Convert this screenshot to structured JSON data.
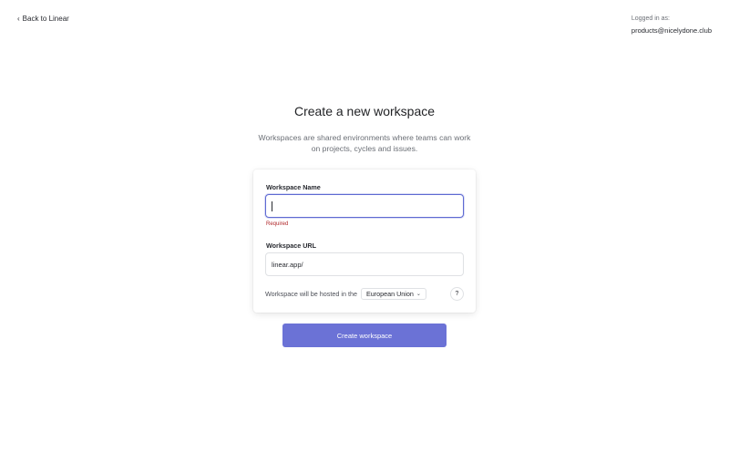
{
  "nav": {
    "back_label": "Back to Linear"
  },
  "account": {
    "label": "Logged in as:",
    "email": "products@nicelydone.club"
  },
  "heading": {
    "title": "Create a new workspace",
    "subtitle": "Workspaces are shared environments where teams can work on projects, cycles and issues."
  },
  "form": {
    "name_label": "Workspace Name",
    "name_value": "",
    "name_error": "Required",
    "url_label": "Workspace URL",
    "url_value": "linear.app/",
    "host_text": "Workspace will be hosted in the",
    "region_selected": "European Union",
    "help_label": "?"
  },
  "actions": {
    "create_label": "Create workspace"
  },
  "colors": {
    "accent": "#6b72d6",
    "focus_border": "#5e6ad2",
    "error": "#b0272a"
  },
  "icons": {
    "back": "chevron-left-icon",
    "dropdown": "chevron-down-icon",
    "help": "question-icon"
  }
}
